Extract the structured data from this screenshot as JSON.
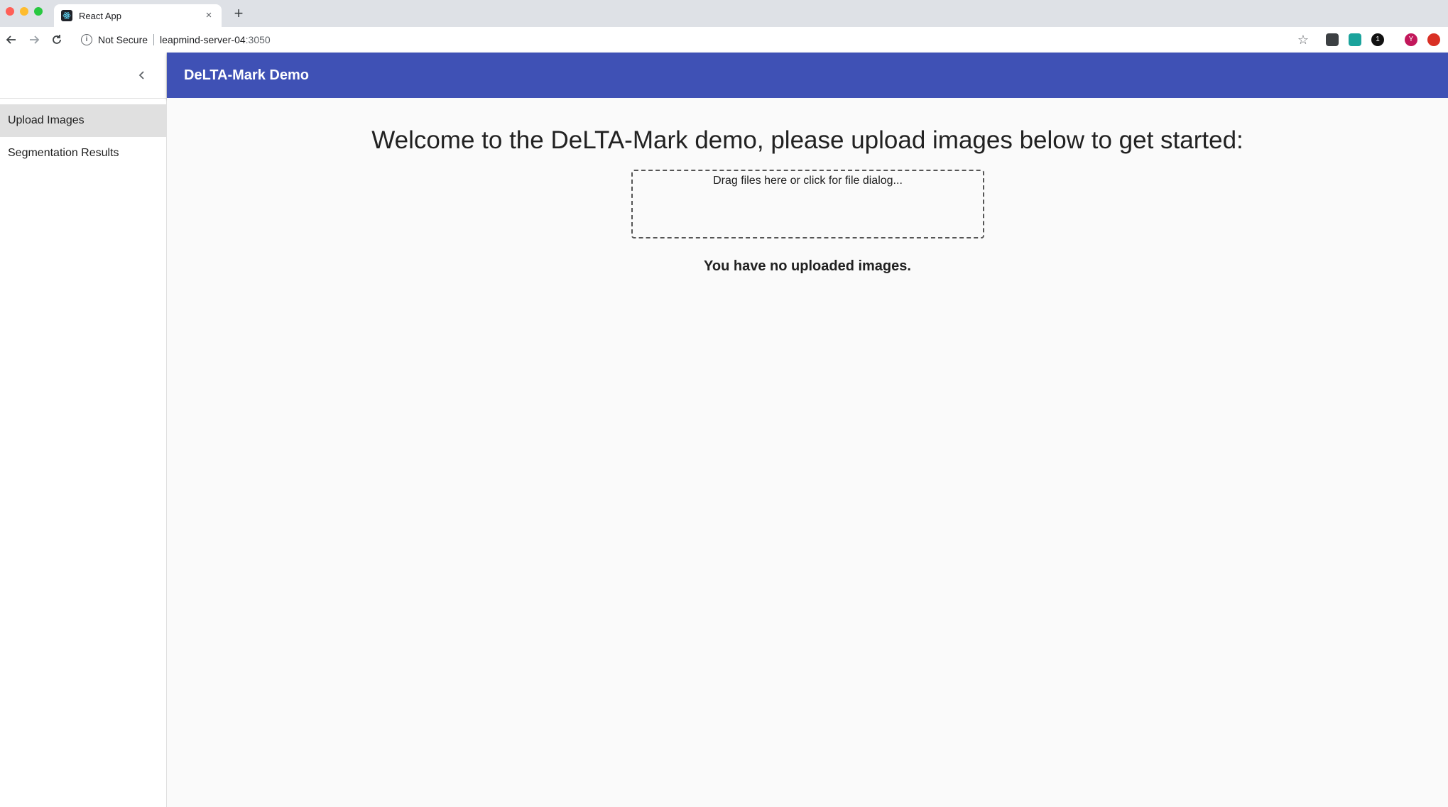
{
  "browser": {
    "tab_title": "React App",
    "tab_close": "×",
    "new_tab": "+",
    "security_label": "Not Secure",
    "url_host": "leapmind-server-04",
    "url_port": ":3050",
    "bookmark": "☆",
    "extensions": [
      {
        "name": "pocket-icon",
        "color": "#3c4043"
      },
      {
        "name": "extension-icon",
        "color": "#1ba39c"
      },
      {
        "name": "password-manager-icon",
        "color": "#111111",
        "label": "1"
      },
      {
        "name": "profile-avatar-icon",
        "color": "#c2185b",
        "label": "Y"
      },
      {
        "name": "update-icon",
        "color": "#d93025"
      }
    ]
  },
  "sidebar": {
    "items": [
      {
        "label": "Upload Images",
        "selected": true
      },
      {
        "label": "Segmentation Results",
        "selected": false
      }
    ]
  },
  "header": {
    "title": "DeLTA-Mark Demo",
    "color": "#3f51b5"
  },
  "main": {
    "welcome": "Welcome to the DeLTA-Mark demo, please upload images below to get started:",
    "dropzone_text": "Drag files here or click for file dialog...",
    "empty_message": "You have no uploaded images."
  }
}
